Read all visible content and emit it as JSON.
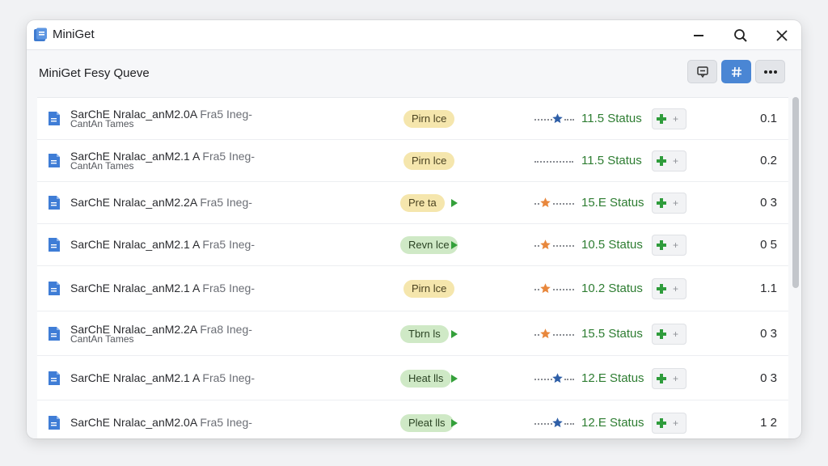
{
  "app": {
    "title": "MiniGet",
    "accent": "#4a86d4"
  },
  "toolbar": {
    "queue_title": "MiniGet Fesy Queve",
    "buttons": [
      "comment-icon",
      "grid-icon",
      "more-icon"
    ]
  },
  "colors": {
    "status_green": "#2e7d32",
    "pill_yellow": "#f5e6ad",
    "pill_green": "#cfe9c6",
    "star_blue": "#2f5fa7",
    "star_orange": "#e8873c"
  },
  "rows": [
    {
      "name": "SarChE Nralac_anM2.0A",
      "kind": "Fra5 Ineg-",
      "sub": "CantAn Tames",
      "pill": "Pirn lce",
      "pill_style": "yellow",
      "pill_arrow": false,
      "star": "blue",
      "status": "11.5 Status",
      "num": "0.1"
    },
    {
      "name": "SarChE Nralac_anM2.1 A",
      "kind": "Fra5 Ineg-",
      "sub": "CantAn Tames",
      "pill": "Pirn lce",
      "pill_style": "yellow",
      "pill_arrow": false,
      "star": "none",
      "status": "11.5 Status",
      "num": "0.2"
    },
    {
      "name": "SarChE Nralac_anM2.2A",
      "kind": "Fra5 Ineg-",
      "sub": "",
      "pill": "Pre ta",
      "pill_style": "yellow",
      "pill_arrow": true,
      "star": "orange",
      "status": "15.E Status",
      "num": "0 3"
    },
    {
      "name": "SarChE Nralac_anM2.1 A",
      "kind": "Fra5 Ineg-",
      "sub": "",
      "pill": "Revn lce",
      "pill_style": "green",
      "pill_arrow": true,
      "star": "orange",
      "status": "10.5 Status",
      "num": "0 5"
    },
    {
      "name": "SarChE Nralac_anM2.1 A",
      "kind": "Fra5 Ineg-",
      "sub": "",
      "pill": "Pirn lce",
      "pill_style": "yellow",
      "pill_arrow": false,
      "star": "orange",
      "status": "10.2 Status",
      "num": "1.1"
    },
    {
      "name": "SarChE Nralac_anM2.2A",
      "kind": "Fra8 Ineg-",
      "sub": "CantAn Tames",
      "pill": "Tbrn ls",
      "pill_style": "green",
      "pill_arrow": true,
      "star": "orange",
      "status": "15.5 Status",
      "num": "0 3"
    },
    {
      "name": "SarChE Nralac_anM2.1 A",
      "kind": "Fra5 Ineg-",
      "sub": "",
      "pill": "Heat lls",
      "pill_style": "green",
      "pill_arrow": true,
      "star": "blue",
      "status": "12.E Status",
      "num": "0 3"
    },
    {
      "name": "SarChE Nralac_anM2.0A",
      "kind": "Fra5 Ineg-",
      "sub": "",
      "pill": "Pleat lls",
      "pill_style": "green",
      "pill_arrow": true,
      "star": "blue",
      "status": "12.E Status",
      "num": "1 2"
    }
  ],
  "scroll": {
    "thumb_fraction": 0.56
  }
}
